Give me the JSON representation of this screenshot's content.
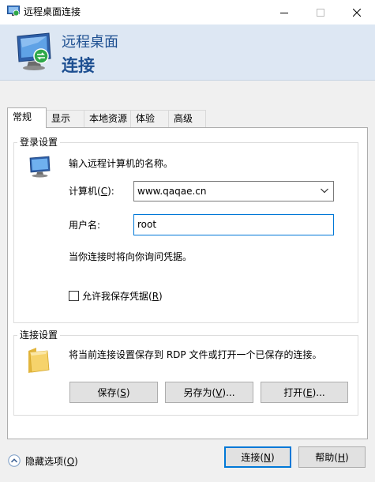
{
  "window": {
    "title": "远程桌面连接",
    "minimize_icon": "minimize-icon",
    "maximize_icon": "maximize-icon",
    "close_icon": "close-icon"
  },
  "banner": {
    "line1": "远程桌面",
    "line2": "连接"
  },
  "tabs": [
    {
      "label": "常规",
      "active": true
    },
    {
      "label": "显示",
      "active": false
    },
    {
      "label": "本地资源",
      "active": false
    },
    {
      "label": "体验",
      "active": false
    },
    {
      "label": "高级",
      "active": false
    }
  ],
  "login": {
    "group_label": "登录设置",
    "instruction": "输入远程计算机的名称。",
    "computer_label_prefix": "计算机(",
    "computer_label_key": "C",
    "computer_label_suffix": "):",
    "computer_value": "www.qaqae.cn",
    "username_label": "用户名:",
    "username_value": "root",
    "prompt_text": "当你连接时将向你询问凭据。",
    "save_creds_prefix": "允许我保存凭据(",
    "save_creds_key": "R",
    "save_creds_suffix": ")",
    "save_creds_checked": false
  },
  "connection": {
    "group_label": "连接设置",
    "description": "将当前连接设置保存到 RDP 文件或打开一个已保存的连接。",
    "save_prefix": "保存(",
    "save_key": "S",
    "save_suffix": ")",
    "saveas_prefix": "另存为(",
    "saveas_key": "V",
    "saveas_suffix": ")...",
    "open_prefix": "打开(",
    "open_key": "E",
    "open_suffix": ")..."
  },
  "footer": {
    "hide_prefix": "隐藏选项(",
    "hide_key": "O",
    "hide_suffix": ")",
    "connect_prefix": "连接(",
    "connect_key": "N",
    "connect_suffix": ")",
    "help_prefix": "帮助(",
    "help_key": "H",
    "help_suffix": ")"
  },
  "colors": {
    "accent": "#0078d7",
    "banner_bg": "#dde7f3",
    "banner_text": "#1d4f91"
  }
}
